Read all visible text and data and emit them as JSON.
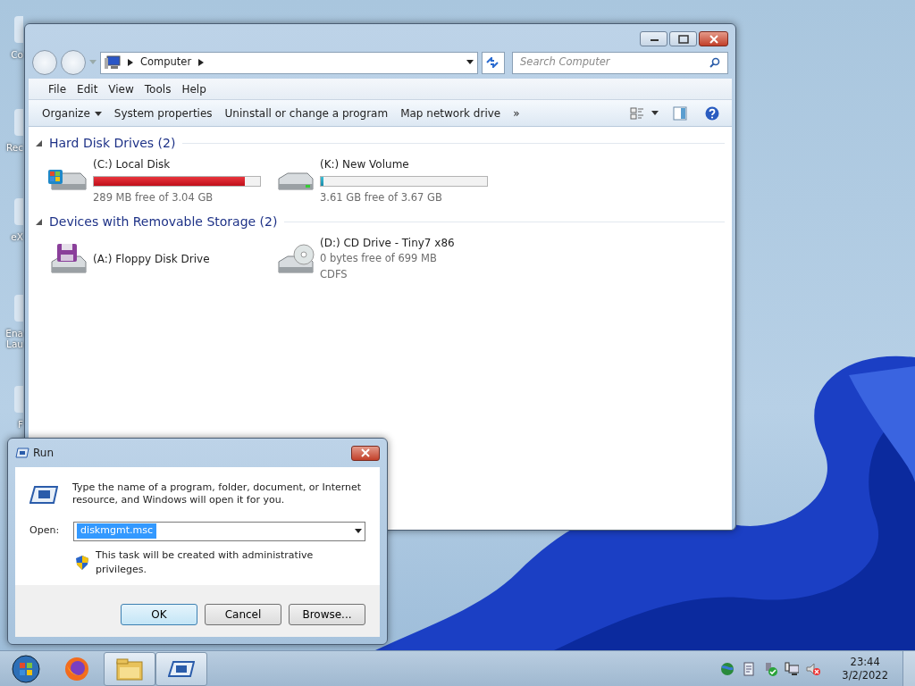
{
  "desktop_icons": [
    {
      "label": "Co"
    },
    {
      "label": "Rec"
    },
    {
      "label": "eX"
    },
    {
      "label": "Ena\nLau"
    },
    {
      "label": "F"
    }
  ],
  "explorer": {
    "address": [
      "Computer"
    ],
    "search": {
      "placeholder": "Search Computer"
    },
    "menu": [
      "File",
      "Edit",
      "View",
      "Tools",
      "Help"
    ],
    "commands": [
      {
        "label": "Organize",
        "dropdown": true
      },
      {
        "label": "System properties",
        "dropdown": false
      },
      {
        "label": "Uninstall or change a program",
        "dropdown": false
      },
      {
        "label": "Map network drive",
        "dropdown": false
      },
      {
        "label": "»",
        "dropdown": false
      }
    ],
    "groups": [
      {
        "title": "Hard Disk Drives (2)",
        "expanded": true,
        "items": [
          {
            "kind": "system",
            "name": "(C:) Local Disk",
            "level": 0.907,
            "low_space": true,
            "lines": [
              "289 MB free of 3.04 GB"
            ]
          },
          {
            "kind": "disk",
            "name": "(K:) New Volume",
            "level": 0.016,
            "low_space": false,
            "lines": [
              "3.61 GB free of 3.67 GB"
            ]
          }
        ]
      },
      {
        "title": "Devices with Removable Storage (2)",
        "expanded": true,
        "items": [
          {
            "kind": "floppy",
            "name": "(A:) Floppy Disk Drive"
          },
          {
            "kind": "cd",
            "name": "(D:) CD Drive - Tiny7 x86",
            "lines": [
              "0 bytes free of 699 MB",
              "CDFS"
            ]
          }
        ]
      }
    ]
  },
  "run": {
    "title": "Run",
    "message": "Type the name of a program, folder, document, or Internet resource, and Windows will open it for you.",
    "open_label": "Open:",
    "value": "diskmgmt.msc",
    "note": "This task will be created with administrative privileges.",
    "buttons": [
      {
        "label": "OK",
        "default": true
      },
      {
        "label": "Cancel",
        "default": false
      },
      {
        "label": "Browse...",
        "default": false
      }
    ]
  },
  "taskbar": {
    "apps": [
      {
        "kind": "firefox",
        "active": false
      },
      {
        "kind": "explorer",
        "active": true
      },
      {
        "kind": "run",
        "active": true
      }
    ],
    "time": "23:44",
    "date": "3/2/2022"
  }
}
